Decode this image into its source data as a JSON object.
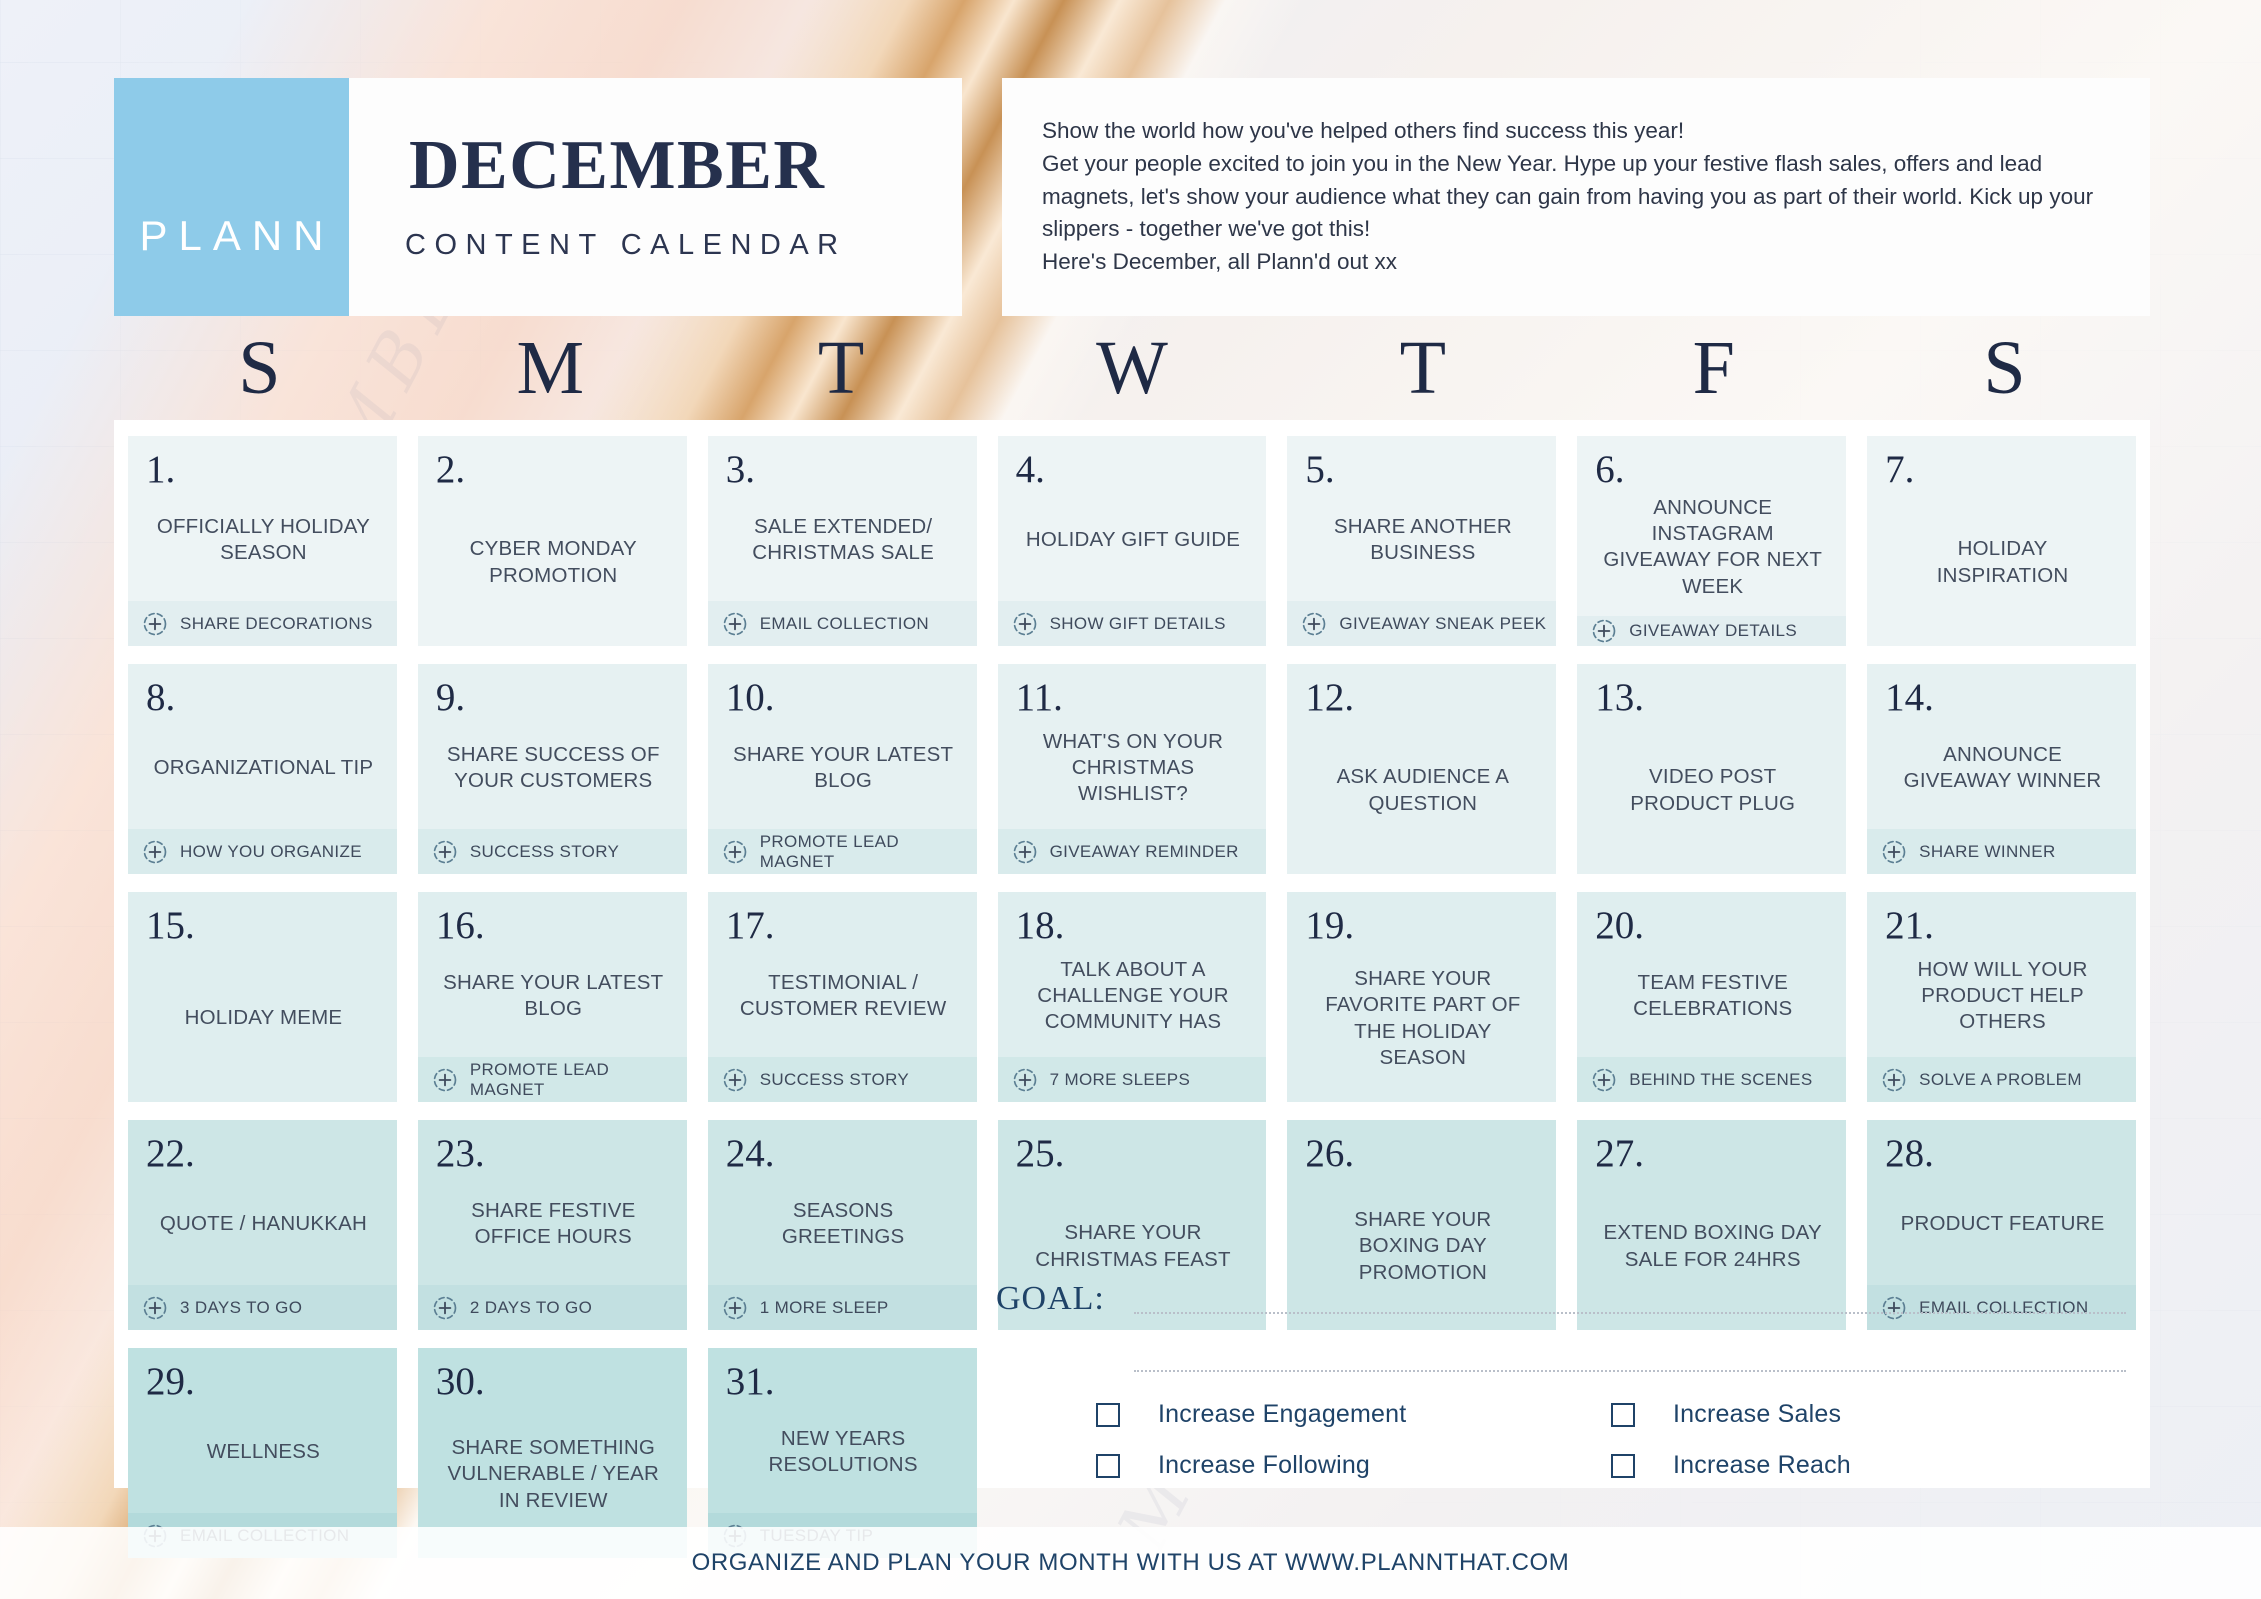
{
  "brand": {
    "logo_text": "PLANN"
  },
  "header": {
    "month": "DECEMBER",
    "subtitle": "CONTENT CALENDAR",
    "intro": "Show the world how you've helped others find success this year!\nGet your people excited to join you in the New Year. Hype up your festive flash sales, offers and lead magnets, let's show your audience what they can gain from having you as part of their world. Kick up your slippers - together we've got this!\nHere's December, all Plann'd out xx"
  },
  "weekdays": [
    "S",
    "M",
    "T",
    "W",
    "T",
    "F",
    "S"
  ],
  "days": [
    {
      "num": "1.",
      "caption": "OFFICIALLY HOLIDAY SEASON",
      "story": "SHARE DECORATIONS",
      "tier": 1
    },
    {
      "num": "2.",
      "caption": "CYBER MONDAY PROMOTION",
      "story": "",
      "tier": 1
    },
    {
      "num": "3.",
      "caption": "SALE EXTENDED/ CHRISTMAS SALE",
      "story": "EMAIL COLLECTION",
      "tier": 1
    },
    {
      "num": "4.",
      "caption": "HOLIDAY GIFT GUIDE",
      "story": "SHOW GIFT DETAILS",
      "tier": 1
    },
    {
      "num": "5.",
      "caption": "SHARE ANOTHER BUSINESS",
      "story": "GIVEAWAY SNEAK PEEK",
      "tier": 1
    },
    {
      "num": "6.",
      "caption": "ANNOUNCE INSTAGRAM GIVEAWAY FOR NEXT WEEK",
      "story": "GIVEAWAY DETAILS",
      "tier": 1
    },
    {
      "num": "7.",
      "caption": "HOLIDAY INSPIRATION",
      "story": "",
      "tier": 1
    },
    {
      "num": "8.",
      "caption": "ORGANIZATIONAL TIP",
      "story": "HOW YOU ORGANIZE",
      "tier": 2
    },
    {
      "num": "9.",
      "caption": "SHARE SUCCESS OF YOUR CUSTOMERS",
      "story": "SUCCESS STORY",
      "tier": 2
    },
    {
      "num": "10.",
      "caption": "SHARE YOUR LATEST BLOG",
      "story": "PROMOTE LEAD MAGNET",
      "tier": 2
    },
    {
      "num": "11.",
      "caption": "WHAT'S ON YOUR CHRISTMAS WISHLIST?",
      "story": "GIVEAWAY REMINDER",
      "tier": 2
    },
    {
      "num": "12.",
      "caption": "ASK AUDIENCE A QUESTION",
      "story": "",
      "tier": 2
    },
    {
      "num": "13.",
      "caption": "VIDEO POST PRODUCT PLUG",
      "story": "",
      "tier": 2
    },
    {
      "num": "14.",
      "caption": "ANNOUNCE GIVEAWAY WINNER",
      "story": "SHARE WINNER",
      "tier": 2
    },
    {
      "num": "15.",
      "caption": "HOLIDAY MEME",
      "story": "",
      "tier": 3
    },
    {
      "num": "16.",
      "caption": "SHARE YOUR LATEST BLOG",
      "story": "PROMOTE LEAD MAGNET",
      "tier": 3
    },
    {
      "num": "17.",
      "caption": "TESTIMONIAL / CUSTOMER REVIEW",
      "story": "SUCCESS STORY",
      "tier": 3
    },
    {
      "num": "18.",
      "caption": "TALK ABOUT A CHALLENGE YOUR COMMUNITY HAS",
      "story": "7 MORE SLEEPS",
      "tier": 3
    },
    {
      "num": "19.",
      "caption": "SHARE YOUR FAVORITE PART OF THE HOLIDAY SEASON",
      "story": "",
      "tier": 3
    },
    {
      "num": "20.",
      "caption": "TEAM FESTIVE CELEBRATIONS",
      "story": "BEHIND THE SCENES",
      "tier": 3
    },
    {
      "num": "21.",
      "caption": "HOW WILL YOUR PRODUCT HELP OTHERS",
      "story": "SOLVE A PROBLEM",
      "tier": 3
    },
    {
      "num": "22.",
      "caption": "QUOTE / HANUKKAH",
      "story": "3 DAYS TO GO",
      "tier": 4
    },
    {
      "num": "23.",
      "caption": "SHARE FESTIVE OFFICE HOURS",
      "story": "2 DAYS TO GO",
      "tier": 4
    },
    {
      "num": "24.",
      "caption": "SEASONS GREETINGS",
      "story": "1 MORE SLEEP",
      "tier": 4
    },
    {
      "num": "25.",
      "caption": "SHARE YOUR CHRISTMAS FEAST",
      "story": "",
      "tier": 4
    },
    {
      "num": "26.",
      "caption": "SHARE YOUR BOXING DAY PROMOTION",
      "story": "",
      "tier": 4
    },
    {
      "num": "27.",
      "caption": "EXTEND BOXING DAY SALE FOR 24HRS",
      "story": "",
      "tier": 4
    },
    {
      "num": "28.",
      "caption": "PRODUCT FEATURE",
      "story": "EMAIL COLLECTION",
      "tier": 4
    },
    {
      "num": "29.",
      "caption": "WELLNESS",
      "story": "EMAIL COLLECTION",
      "tier": 5
    },
    {
      "num": "30.",
      "caption": "SHARE SOMETHING VULNERABLE / YEAR IN REVIEW",
      "story": "",
      "tier": 5
    },
    {
      "num": "31.",
      "caption": "NEW YEARS RESOLUTIONS",
      "story": "TUESDAY TIP",
      "tier": 5
    }
  ],
  "goal": {
    "label": "GOAL:",
    "options": [
      "Increase Engagement",
      "Increase Sales",
      "Increase Following",
      "Increase Reach"
    ]
  },
  "footer": {
    "text": "ORGANIZE AND PLAN YOUR MONTH WITH US AT WWW.PLANNTHAT.COM"
  },
  "colors": {
    "logo_blue": "#8ecbe9",
    "title_navy": "#25304d",
    "highlight_teal": "#a5d4cf",
    "cell_teal": "#bfe1e1",
    "goal_navy": "#1f4368"
  }
}
